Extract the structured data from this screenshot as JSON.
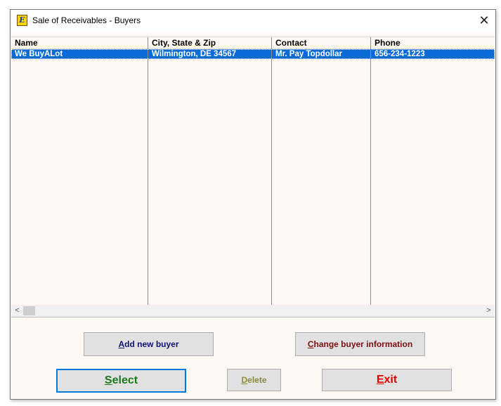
{
  "window": {
    "title": "Sale of Receivables - Buyers",
    "close_glyph": "✕",
    "icon_letter": "E"
  },
  "table": {
    "columns": [
      "Name",
      "City, State & Zip",
      "Contact",
      "Phone"
    ],
    "rows": [
      {
        "name": "We BuyALot",
        "city": "Wilmington, DE 34567",
        "contact": "Mr. Pay Topdollar",
        "phone": "656-234-1223"
      }
    ],
    "selected_row_color": "#0a6bd8"
  },
  "scrollbar": {
    "left_arrow": "<",
    "right_arrow": ">"
  },
  "buttons": {
    "add_accel": "A",
    "add_rest": "dd new buyer",
    "add_color": "#101070",
    "change_accel": "C",
    "change_rest": "hange buyer information",
    "change_color": "#7a1010",
    "select_accel": "S",
    "select_rest": "elect",
    "select_color": "#1a7a1a",
    "delete_accel": "D",
    "delete_rest": "elete",
    "delete_color": "#8a8a3a",
    "exit_accel": "E",
    "exit_rest": "xit",
    "exit_color": "#e00000"
  }
}
